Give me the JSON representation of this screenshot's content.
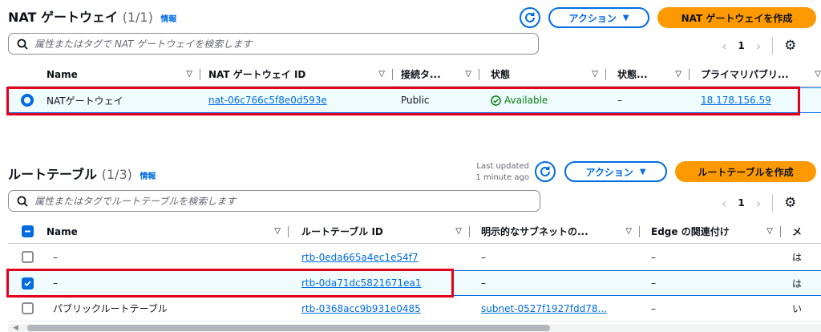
{
  "nat": {
    "title": "NAT ゲートウェイ",
    "count": "(1/1)",
    "info": "情報",
    "action_label": "アクション",
    "create_label": "NAT ゲートウェイを作成",
    "search_placeholder": "属性またはタグで NAT ゲートウェイを検索します",
    "page": "1",
    "columns": [
      "Name",
      "NAT ゲートウェイ ID",
      "接続タ...",
      "状態",
      "状態...",
      "プライマリパブリ..."
    ],
    "row": {
      "name": "NATゲートウェイ",
      "id": "nat-06c766c5f8e0d593e",
      "conn": "Public",
      "state": "Available",
      "state_msg": "–",
      "ip": "18.178.156.59"
    }
  },
  "rt": {
    "title": "ルートテーブル",
    "count": "(1/3)",
    "info": "情報",
    "last_updated": "Last updated",
    "last_updated_ago": "1 minute ago",
    "action_label": "アクション",
    "create_label": "ルートテーブルを作成",
    "search_placeholder": "属性またはタグでルートテーブルを検索します",
    "page": "1",
    "columns": [
      "Name",
      "ルートテーブル ID",
      "明示的なサブネットの...",
      "Edge の関連付け",
      "メ"
    ],
    "rows": [
      {
        "name": "–",
        "id": "rtb-0eda665a4ec1e54f7",
        "subnet": "–",
        "edge": "–",
        "main": "は"
      },
      {
        "name": "–",
        "id": "rtb-0da71dc5821671ea1",
        "subnet": "–",
        "edge": "–",
        "main": "は"
      },
      {
        "name": "パブリックルートテーブル",
        "id": "rtb-0368acc9b931e0485",
        "subnet": "subnet-0527f1927fdd78...",
        "edge": "–",
        "main": "い"
      }
    ]
  },
  "colors": {
    "accent": "#006ce0",
    "primary": "#ff9900",
    "highlight": "#e3001b",
    "available": "#037f0c"
  }
}
